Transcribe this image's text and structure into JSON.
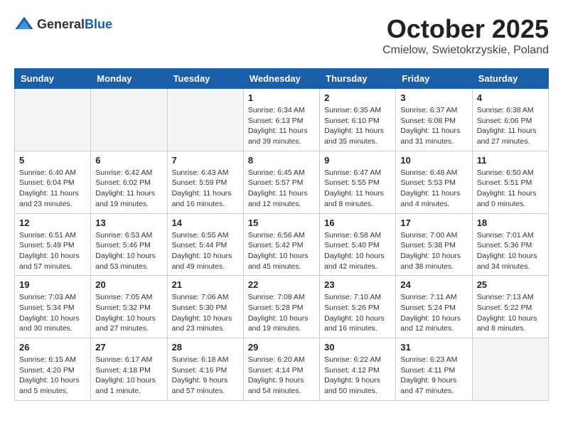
{
  "header": {
    "logo_general": "General",
    "logo_blue": "Blue",
    "month": "October 2025",
    "location": "Cmielow, Swietokrzyskie, Poland"
  },
  "weekdays": [
    "Sunday",
    "Monday",
    "Tuesday",
    "Wednesday",
    "Thursday",
    "Friday",
    "Saturday"
  ],
  "weeks": [
    [
      {
        "day": "",
        "info": "",
        "empty": true
      },
      {
        "day": "",
        "info": "",
        "empty": true
      },
      {
        "day": "",
        "info": "",
        "empty": true
      },
      {
        "day": "1",
        "info": "Sunrise: 6:34 AM\nSunset: 6:13 PM\nDaylight: 11 hours\nand 39 minutes.",
        "empty": false
      },
      {
        "day": "2",
        "info": "Sunrise: 6:35 AM\nSunset: 6:10 PM\nDaylight: 11 hours\nand 35 minutes.",
        "empty": false
      },
      {
        "day": "3",
        "info": "Sunrise: 6:37 AM\nSunset: 6:08 PM\nDaylight: 11 hours\nand 31 minutes.",
        "empty": false
      },
      {
        "day": "4",
        "info": "Sunrise: 6:38 AM\nSunset: 6:06 PM\nDaylight: 11 hours\nand 27 minutes.",
        "empty": false
      }
    ],
    [
      {
        "day": "5",
        "info": "Sunrise: 6:40 AM\nSunset: 6:04 PM\nDaylight: 11 hours\nand 23 minutes.",
        "empty": false
      },
      {
        "day": "6",
        "info": "Sunrise: 6:42 AM\nSunset: 6:02 PM\nDaylight: 11 hours\nand 19 minutes.",
        "empty": false
      },
      {
        "day": "7",
        "info": "Sunrise: 6:43 AM\nSunset: 5:59 PM\nDaylight: 11 hours\nand 16 minutes.",
        "empty": false
      },
      {
        "day": "8",
        "info": "Sunrise: 6:45 AM\nSunset: 5:57 PM\nDaylight: 11 hours\nand 12 minutes.",
        "empty": false
      },
      {
        "day": "9",
        "info": "Sunrise: 6:47 AM\nSunset: 5:55 PM\nDaylight: 11 hours\nand 8 minutes.",
        "empty": false
      },
      {
        "day": "10",
        "info": "Sunrise: 6:48 AM\nSunset: 5:53 PM\nDaylight: 11 hours\nand 4 minutes.",
        "empty": false
      },
      {
        "day": "11",
        "info": "Sunrise: 6:50 AM\nSunset: 5:51 PM\nDaylight: 11 hours\nand 0 minutes.",
        "empty": false
      }
    ],
    [
      {
        "day": "12",
        "info": "Sunrise: 6:51 AM\nSunset: 5:49 PM\nDaylight: 10 hours\nand 57 minutes.",
        "empty": false
      },
      {
        "day": "13",
        "info": "Sunrise: 6:53 AM\nSunset: 5:46 PM\nDaylight: 10 hours\nand 53 minutes.",
        "empty": false
      },
      {
        "day": "14",
        "info": "Sunrise: 6:55 AM\nSunset: 5:44 PM\nDaylight: 10 hours\nand 49 minutes.",
        "empty": false
      },
      {
        "day": "15",
        "info": "Sunrise: 6:56 AM\nSunset: 5:42 PM\nDaylight: 10 hours\nand 45 minutes.",
        "empty": false
      },
      {
        "day": "16",
        "info": "Sunrise: 6:58 AM\nSunset: 5:40 PM\nDaylight: 10 hours\nand 42 minutes.",
        "empty": false
      },
      {
        "day": "17",
        "info": "Sunrise: 7:00 AM\nSunset: 5:38 PM\nDaylight: 10 hours\nand 38 minutes.",
        "empty": false
      },
      {
        "day": "18",
        "info": "Sunrise: 7:01 AM\nSunset: 5:36 PM\nDaylight: 10 hours\nand 34 minutes.",
        "empty": false
      }
    ],
    [
      {
        "day": "19",
        "info": "Sunrise: 7:03 AM\nSunset: 5:34 PM\nDaylight: 10 hours\nand 30 minutes.",
        "empty": false
      },
      {
        "day": "20",
        "info": "Sunrise: 7:05 AM\nSunset: 5:32 PM\nDaylight: 10 hours\nand 27 minutes.",
        "empty": false
      },
      {
        "day": "21",
        "info": "Sunrise: 7:06 AM\nSunset: 5:30 PM\nDaylight: 10 hours\nand 23 minutes.",
        "empty": false
      },
      {
        "day": "22",
        "info": "Sunrise: 7:08 AM\nSunset: 5:28 PM\nDaylight: 10 hours\nand 19 minutes.",
        "empty": false
      },
      {
        "day": "23",
        "info": "Sunrise: 7:10 AM\nSunset: 5:26 PM\nDaylight: 10 hours\nand 16 minutes.",
        "empty": false
      },
      {
        "day": "24",
        "info": "Sunrise: 7:11 AM\nSunset: 5:24 PM\nDaylight: 10 hours\nand 12 minutes.",
        "empty": false
      },
      {
        "day": "25",
        "info": "Sunrise: 7:13 AM\nSunset: 5:22 PM\nDaylight: 10 hours\nand 8 minutes.",
        "empty": false
      }
    ],
    [
      {
        "day": "26",
        "info": "Sunrise: 6:15 AM\nSunset: 4:20 PM\nDaylight: 10 hours\nand 5 minutes.",
        "empty": false
      },
      {
        "day": "27",
        "info": "Sunrise: 6:17 AM\nSunset: 4:18 PM\nDaylight: 10 hours\nand 1 minute.",
        "empty": false
      },
      {
        "day": "28",
        "info": "Sunrise: 6:18 AM\nSunset: 4:16 PM\nDaylight: 9 hours\nand 57 minutes.",
        "empty": false
      },
      {
        "day": "29",
        "info": "Sunrise: 6:20 AM\nSunset: 4:14 PM\nDaylight: 9 hours\nand 54 minutes.",
        "empty": false
      },
      {
        "day": "30",
        "info": "Sunrise: 6:22 AM\nSunset: 4:12 PM\nDaylight: 9 hours\nand 50 minutes.",
        "empty": false
      },
      {
        "day": "31",
        "info": "Sunrise: 6:23 AM\nSunset: 4:11 PM\nDaylight: 9 hours\nand 47 minutes.",
        "empty": false
      },
      {
        "day": "",
        "info": "",
        "empty": true
      }
    ]
  ]
}
